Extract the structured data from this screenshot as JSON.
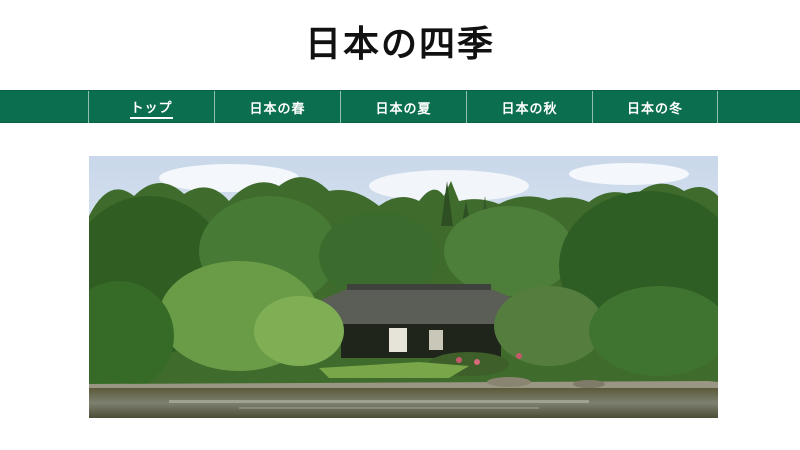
{
  "site": {
    "title": "日本の四季"
  },
  "nav": {
    "items": [
      {
        "label": "トップ",
        "active": true
      },
      {
        "label": "日本の春",
        "active": false
      },
      {
        "label": "日本の夏",
        "active": false
      },
      {
        "label": "日本の秋",
        "active": false
      },
      {
        "label": "日本の冬",
        "active": false
      }
    ]
  },
  "colors": {
    "nav_background": "#0b6f4f",
    "nav_text": "#ffffff",
    "title_text": "#111111"
  },
  "hero": {
    "subject": "japanese-garden-pond-photo"
  }
}
